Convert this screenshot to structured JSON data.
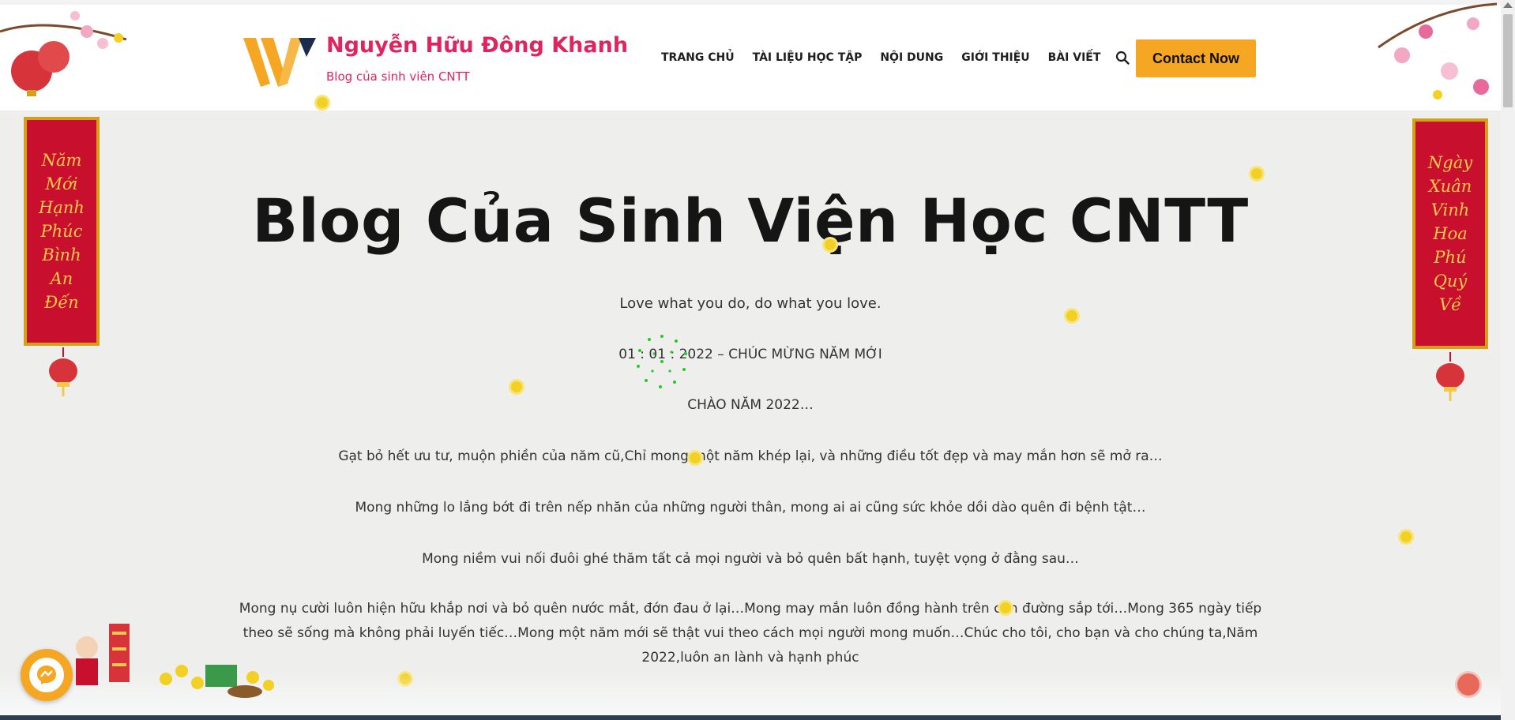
{
  "header": {
    "site_title": "Nguyễn Hữu Đông Khanh",
    "site_tagline": "Blog của sinh viên CNTT",
    "nav": [
      "TRANG CHỦ",
      "TÀI LIỆU HỌC TẬP",
      "NỘI DUNG",
      "GIỚI THIỆU",
      "BÀI VIẾT"
    ],
    "contact_label": "Contact Now"
  },
  "main": {
    "title": "Blog Của Sinh Viện Học CNTT",
    "paragraphs": [
      "Love what you do, do what you love.",
      "01 : 01 : 2022 – CHÚC MỪNG NĂM MỚI",
      "CHÀO NĂM 2022…",
      "Gạt bỏ hết ưu tư, muộn phiền của năm cũ,Chỉ mong một năm khép lại, và những điều tốt đẹp và may mắn hơn sẽ mở ra…",
      "Mong những lo lắng bớt đi trên nếp nhăn của những người thân, mong ai ai cũng sức khỏe dồi dào quên đi bệnh tật…",
      "Mong niềm vui nối đuôi ghé thăm tất cả mọi người và bỏ quên bất hạnh, tuyệt vọng ở đằng sau…",
      "Mong nụ cười luôn hiện hữu khắp nơi và bỏ quên nước mắt, đớn đau ở lại…Mong may mắn luôn đồng hành trên con đường sắp tới…Mong 365 ngày tiếp theo sẽ sống mà không phải luyến tiếc…Mong một năm mới sẽ thật vui theo cách mọi người mong muốn…Chúc cho tôi, cho bạn và cho chúng ta,Năm 2022,luôn an lành và hạnh phúc"
    ]
  },
  "decor": {
    "left_banner": "Năm\nMới\nHạnh\nPhúc\nBình\nAn\nĐến",
    "right_banner": "Ngày\nXuân\nVinh\nHoa\nPhú\nQuý\nVề"
  },
  "colors": {
    "brand_pink": "#e0245e",
    "accent_orange": "#f5a623",
    "banner_red": "#c8102e",
    "banner_gold": "#f2c94c"
  },
  "icons": [
    "logo-w-icon",
    "search-icon",
    "messenger-icon",
    "back-to-top-icon",
    "lantern-icon",
    "apricot-flower-icon"
  ]
}
